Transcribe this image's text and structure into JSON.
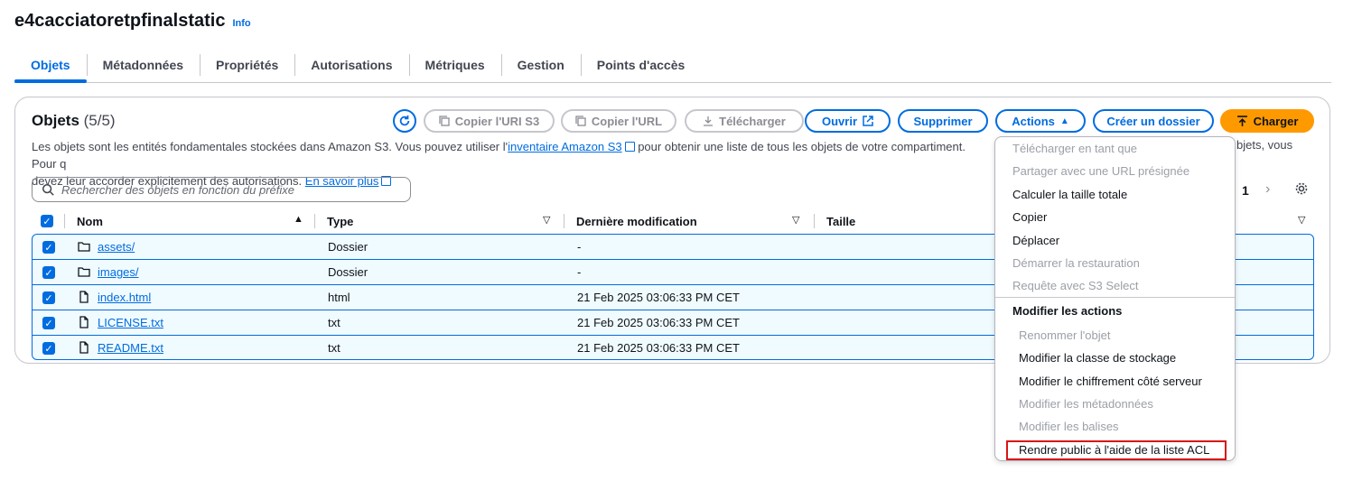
{
  "bucket": {
    "name": "e4cacciatoretpfinalstatic",
    "info_label": "Info"
  },
  "tabs": [
    {
      "label": "Objets"
    },
    {
      "label": "Métadonnées"
    },
    {
      "label": "Propriétés"
    },
    {
      "label": "Autorisations"
    },
    {
      "label": "Métriques"
    },
    {
      "label": "Gestion"
    },
    {
      "label": "Points d'accès"
    }
  ],
  "panel": {
    "title": "Objets",
    "count": "(5/5)",
    "description_1": "Les objets sont les entités fondamentales stockées dans Amazon S3. Vous pouvez utiliser l'",
    "inventory_link": "inventaire Amazon S3",
    "description_2": " pour obtenir une liste de tous les objets de votre compartiment. Pour q",
    "description_3": "devez leur accorder explicitement des autorisations.",
    "learn_more": "En savoir plus",
    "description_right": "bjets, vous"
  },
  "toolbar": {
    "copy_uri": "Copier l'URI S3",
    "copy_url": "Copier l'URL",
    "download": "Télécharger",
    "open": "Ouvrir",
    "delete": "Supprimer",
    "actions": "Actions",
    "create_folder": "Créer un dossier",
    "upload": "Charger"
  },
  "search": {
    "placeholder": "Rechercher des objets en fonction du préfixe"
  },
  "pagination": {
    "page": "1"
  },
  "table": {
    "columns": {
      "name": "Nom",
      "type": "Type",
      "modified": "Dernière modification",
      "size": "Taille"
    },
    "rows": [
      {
        "name": "assets/",
        "type": "Dossier",
        "modified": "-",
        "icon": "folder-icon"
      },
      {
        "name": "images/",
        "type": "Dossier",
        "modified": "-",
        "icon": "folder-icon"
      },
      {
        "name": "index.html",
        "type": "html",
        "modified": "21 Feb 2025 03:06:33 PM CET",
        "icon": "file-icon"
      },
      {
        "name": "LICENSE.txt",
        "type": "txt",
        "modified": "21 Feb 2025 03:06:33 PM CET",
        "icon": "file-icon"
      },
      {
        "name": "README.txt",
        "type": "txt",
        "modified": "21 Feb 2025 03:06:33 PM CET",
        "icon": "file-icon"
      }
    ]
  },
  "actions_menu": {
    "items": [
      {
        "label": "Télécharger en tant que",
        "disabled": true
      },
      {
        "label": "Partager avec une URL présignée",
        "disabled": true
      },
      {
        "label": "Calculer la taille totale",
        "disabled": false
      },
      {
        "label": "Copier",
        "disabled": false
      },
      {
        "label": "Déplacer",
        "disabled": false
      },
      {
        "label": "Démarrer la restauration",
        "disabled": true
      },
      {
        "label": "Requête avec S3 Select",
        "disabled": true
      }
    ],
    "group_label": "Modifier les actions",
    "group_items": [
      {
        "label": "Renommer l'objet",
        "disabled": true
      },
      {
        "label": "Modifier la classe de stockage",
        "disabled": false
      },
      {
        "label": "Modifier le chiffrement côté serveur",
        "disabled": false
      },
      {
        "label": "Modifier les métadonnées",
        "disabled": true
      },
      {
        "label": "Modifier les balises",
        "disabled": true
      },
      {
        "label": "Rendre public à l'aide de la liste ACL",
        "disabled": false
      }
    ]
  },
  "colors": {
    "accent": "#006ce0",
    "primary_button": "#ff9900",
    "highlight": "#d91515"
  }
}
